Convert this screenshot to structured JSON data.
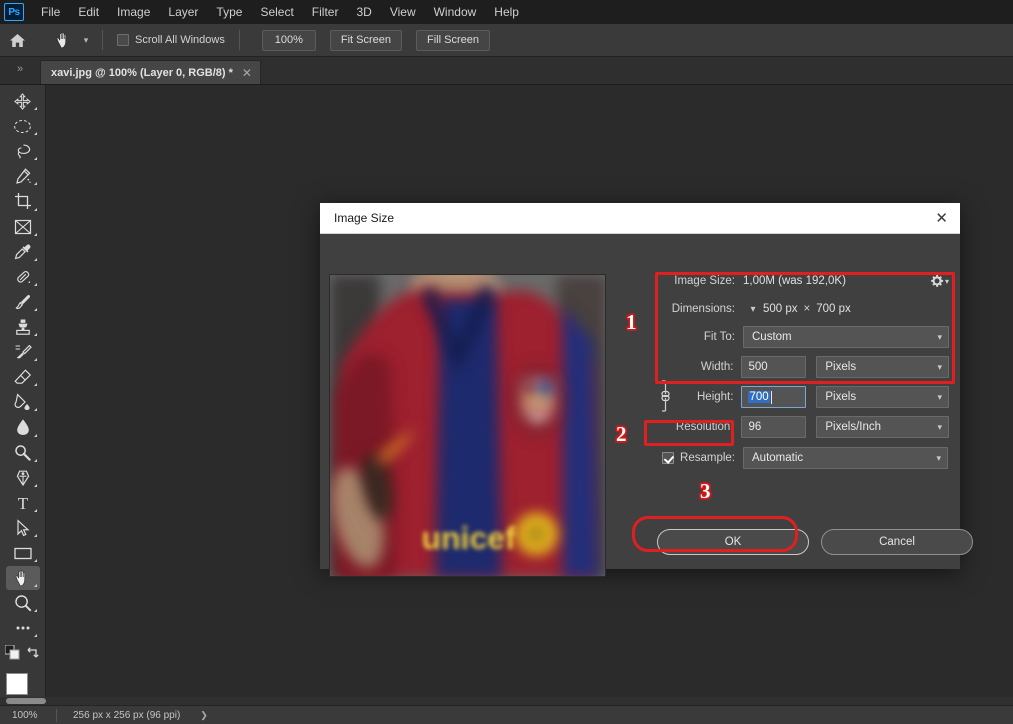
{
  "app": {
    "logo_text": "Ps",
    "menus": [
      "File",
      "Edit",
      "Image",
      "Layer",
      "Type",
      "Select",
      "Filter",
      "3D",
      "View",
      "Window",
      "Help"
    ]
  },
  "options_bar": {
    "home_icon": "home-icon",
    "tool_icon": "hand-tool-icon",
    "preset_caret": "chevron-down-icon",
    "scroll_all_windows_label": "Scroll All Windows",
    "scroll_all_windows_checked": false,
    "zoom_100_label": "100%",
    "fit_screen_label": "Fit Screen",
    "fill_screen_label": "Fill Screen"
  },
  "tab_bar": {
    "expand_icon": "double-chevron-right-icon",
    "document_tab": {
      "title": "xavi.jpg @ 100% (Layer 0, RGB/8) *",
      "close_icon": "close-icon"
    }
  },
  "toolbar": {
    "tools": [
      {
        "name": "move-tool",
        "selected": false
      },
      {
        "name": "elliptical-marquee-tool",
        "selected": false
      },
      {
        "name": "lasso-tool",
        "selected": false
      },
      {
        "name": "quick-selection-tool",
        "selected": false
      },
      {
        "name": "crop-tool",
        "selected": false
      },
      {
        "name": "frame-tool",
        "selected": false
      },
      {
        "name": "eyedropper-tool",
        "selected": false
      },
      {
        "name": "spot-healing-brush-tool",
        "selected": false
      },
      {
        "name": "brush-tool",
        "selected": false
      },
      {
        "name": "clone-stamp-tool",
        "selected": false
      },
      {
        "name": "history-brush-tool",
        "selected": false
      },
      {
        "name": "eraser-tool",
        "selected": false
      },
      {
        "name": "gradient-tool",
        "selected": false
      },
      {
        "name": "blur-tool",
        "selected": false
      },
      {
        "name": "dodge-tool",
        "selected": false
      },
      {
        "name": "pen-tool",
        "selected": false
      },
      {
        "name": "horizontal-type-tool",
        "selected": false,
        "glyph": "T"
      },
      {
        "name": "path-selection-tool",
        "selected": false
      },
      {
        "name": "rectangle-tool",
        "selected": false
      },
      {
        "name": "hand-tool",
        "selected": true
      },
      {
        "name": "zoom-tool",
        "selected": false
      },
      {
        "name": "edit-toolbar-tool",
        "selected": false
      }
    ],
    "foreground_color": "#ffffff",
    "background_color": "#e8e8e8",
    "default_colors_icon": "default-colors-icon",
    "swap_colors_icon": "swap-colors-icon"
  },
  "dialog": {
    "title": "Image Size",
    "close_icon": "close-icon",
    "image_size": {
      "label": "Image Size:",
      "value": "1,00M (was 192,0K)",
      "gear_icon": "gear-icon"
    },
    "dimensions": {
      "label": "Dimensions:",
      "chevron_icon": "chevron-down-icon",
      "width_value": "500 px",
      "separator": "×",
      "height_value": "700 px"
    },
    "fit_to": {
      "label": "Fit To:",
      "value": "Custom",
      "chevron_icon": "chevron-down-icon"
    },
    "width": {
      "label": "Width:",
      "value": "500",
      "unit": "Pixels",
      "unit_chevron_icon": "chevron-down-icon"
    },
    "height": {
      "label": "Height:",
      "value": "700",
      "selected": true,
      "unit": "Pixels",
      "unit_chevron_icon": "chevron-down-icon"
    },
    "link_icon": "chain-link-icon",
    "resolution": {
      "label": "Resolution:",
      "value": "96",
      "unit": "Pixels/Inch",
      "unit_chevron_icon": "chevron-down-icon"
    },
    "resample": {
      "label": "Resample:",
      "checked": true,
      "value": "Automatic",
      "chevron_icon": "chevron-down-icon"
    },
    "buttons": {
      "ok_label": "OK",
      "cancel_label": "Cancel"
    },
    "preview_alt": "footballer in FC Barcelona jersey with unicef sponsor"
  },
  "annotations": {
    "accent_color": "#e02020",
    "marks": [
      {
        "number": "1",
        "target": "dimensions-width-height-group"
      },
      {
        "number": "2",
        "target": "resample-checkbox"
      },
      {
        "number": "3",
        "target": "ok-button"
      }
    ]
  },
  "status_bar": {
    "zoom": "100%",
    "doc_dimensions": "256 px x 256 px (96 ppi)",
    "expand_icon": "chevron-right-icon"
  }
}
